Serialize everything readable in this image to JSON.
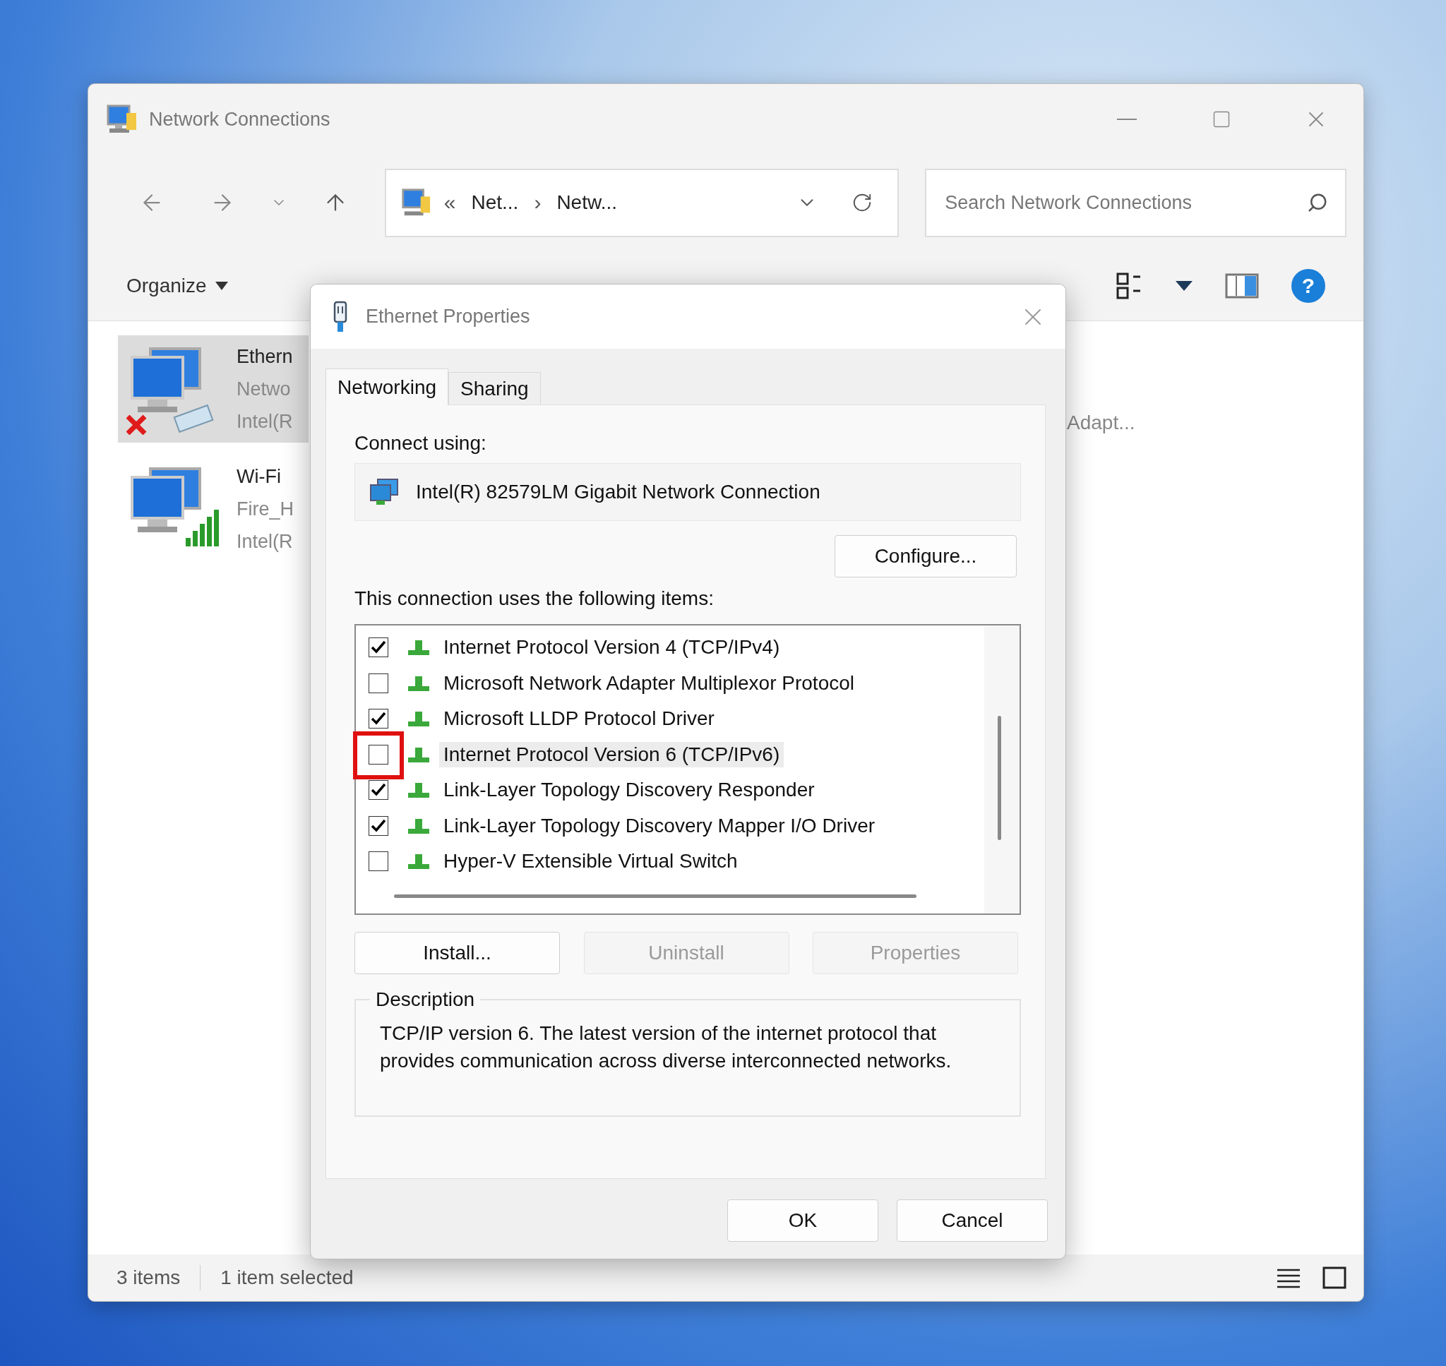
{
  "explorer": {
    "title": "Network Connections",
    "address": {
      "overflow": "«",
      "crumbs": [
        "Net...",
        "Netw..."
      ],
      "separator": "›"
    },
    "search": {
      "placeholder": "Search Network Connections"
    },
    "command_bar": {
      "organize": "Organize",
      "help_button": "?"
    },
    "connections": [
      {
        "name": "Ethern",
        "line_2": "Netwo",
        "line_3": "Intel(R",
        "kind": "ethernet",
        "selected": true
      },
      {
        "name": "Wi-Fi",
        "line_2": "Fire_H",
        "line_3": "Intel(R",
        "kind": "wifi",
        "selected": false
      }
    ],
    "column_text": "Adapt...",
    "status_bar": {
      "count": "3 items",
      "selection": "1 item selected"
    }
  },
  "dialog": {
    "title": "Ethernet Properties",
    "tabs": [
      {
        "label": "Networking",
        "selected": true
      },
      {
        "label": "Sharing",
        "selected": false
      }
    ],
    "connect_using_label": "Connect using:",
    "adapter": "Intel(R) 82579LM Gigabit Network Connection",
    "configure_button": "Configure...",
    "items_label": "This connection uses the following items:",
    "items": [
      {
        "label": "Internet Protocol Version 4 (TCP/IPv4)",
        "checked": true,
        "selected": false,
        "annotated": false
      },
      {
        "label": "Microsoft Network Adapter Multiplexor Protocol",
        "checked": false,
        "selected": false,
        "annotated": false
      },
      {
        "label": "Microsoft LLDP Protocol Driver",
        "checked": true,
        "selected": false,
        "annotated": false
      },
      {
        "label": "Internet Protocol Version 6 (TCP/IPv6)",
        "checked": false,
        "selected": true,
        "annotated": true
      },
      {
        "label": "Link-Layer Topology Discovery Responder",
        "checked": true,
        "selected": false,
        "annotated": false
      },
      {
        "label": "Link-Layer Topology Discovery Mapper I/O Driver",
        "checked": true,
        "selected": false,
        "annotated": false
      },
      {
        "label": "Hyper-V Extensible Virtual Switch",
        "checked": false,
        "selected": false,
        "annotated": false
      }
    ],
    "item_buttons": [
      {
        "label": "Install...",
        "disabled": false
      },
      {
        "label": "Uninstall",
        "disabled": true
      },
      {
        "label": "Properties",
        "disabled": true
      }
    ],
    "description": {
      "legend": "Description",
      "text": "TCP/IP version 6. The latest version of the internet protocol that provides communication across diverse interconnected networks."
    },
    "buttons": [
      "OK",
      "Cancel"
    ]
  }
}
